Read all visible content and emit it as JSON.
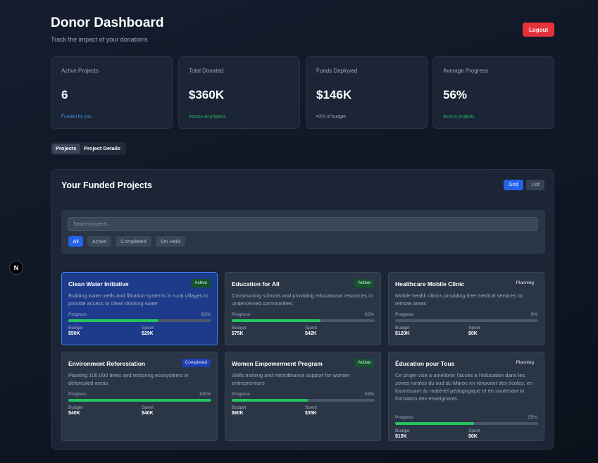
{
  "header": {
    "title": "Donor Dashboard",
    "subtitle": "Track the impact of your donations",
    "logout_label": "Logout"
  },
  "stats": [
    {
      "label": "Active Projects",
      "value": "6",
      "sub": "Funded by you",
      "color": "#4a9bf5"
    },
    {
      "label": "Total Donated",
      "value": "$360K",
      "sub": "Across all projects",
      "color": "#27c46b"
    },
    {
      "label": "Funds Deployed",
      "value": "$146K",
      "sub": "41% of budget",
      "color": "#a8b2c0"
    },
    {
      "label": "Average Progress",
      "value": "56%",
      "sub": "Across projects",
      "color": "#27c46b"
    }
  ],
  "tabs": [
    {
      "label": "Projects",
      "active": true
    },
    {
      "label": "Project Details",
      "active": false
    }
  ],
  "panel": {
    "title": "Your Funded Projects",
    "view_grid": "Grid",
    "view_list": "List",
    "search_placeholder": "Search projects...",
    "filters": [
      "All",
      "Active",
      "Completed",
      "On Hold"
    ]
  },
  "project_labels": {
    "progress": "Progress",
    "budget": "Budget",
    "spent": "Spent"
  },
  "projects": [
    {
      "title": "Clean Water Initiative",
      "status": "Active",
      "desc": "Building water wells and filtration systems in rural villages to provide access to clean drinking water",
      "progress": 63,
      "progress_text": "63%",
      "budget": "$50K",
      "spent": "$29K"
    },
    {
      "title": "Education for All",
      "status": "Active",
      "desc": "Constructing schools and providing educational resources in underserved communities",
      "progress": 62,
      "progress_text": "62%",
      "budget": "$75K",
      "spent": "$42K"
    },
    {
      "title": "Healthcare Mobile Clinic",
      "status": "Planning",
      "desc": "Mobile health clinics providing free medical services to remote areas",
      "progress": 0,
      "progress_text": "0%",
      "budget": "$120K",
      "spent": "$0K"
    },
    {
      "title": "Environment Reforestation",
      "status": "Completed",
      "desc": "Planting 100,000 trees and restoring ecosystems in deforested areas",
      "progress": 100,
      "progress_text": "100%",
      "budget": "$40K",
      "spent": "$40K"
    },
    {
      "title": "Women Empowerment Program",
      "status": "Active",
      "desc": "Skills training and microfinance support for women entrepreneurs",
      "progress": 53,
      "progress_text": "53%",
      "budget": "$60K",
      "spent": "$35K"
    },
    {
      "title": "Éducation pour Tous",
      "status": "Planning",
      "desc": "Ce projet vise à améliorer l'accès à l'éducation dans les zones rurales du sud du Maroc en rénovant des écoles, en fournissant du matériel pédagogique et en soutenant la formation des enseignants.",
      "progress": 55,
      "progress_text": "55%",
      "budget": "$15K",
      "spent": "$0K"
    }
  ],
  "logo_letter": "N"
}
